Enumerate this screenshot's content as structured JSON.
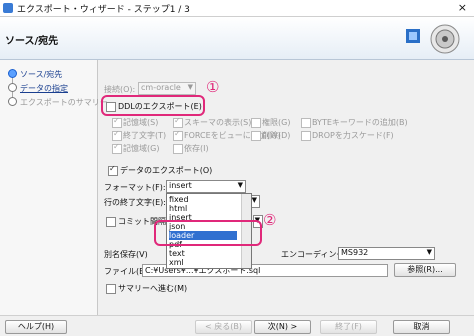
{
  "window": {
    "title": "エクスポート・ウィザード - ステップ1 / 3",
    "close": "×"
  },
  "header": {
    "title": "ソース/宛先"
  },
  "nav": [
    {
      "label": "ソース/宛先",
      "state": "active"
    },
    {
      "label": "データの指定",
      "state": "link"
    },
    {
      "label": "エクスポートのサマリー",
      "state": "disabled"
    }
  ],
  "connection": {
    "label": "接続(O):",
    "value": "cm-oracle"
  },
  "ddl": {
    "label": "DDLのエクスポート(E)"
  },
  "ddl_options": [
    {
      "label": "記憶域(S)",
      "checked": true
    },
    {
      "label": "スキーマの表示(S)",
      "checked": true
    },
    {
      "label": "権限(G)",
      "checked": false
    },
    {
      "label": "BYTEキーワードの追加(B)",
      "checked": false
    },
    {
      "label": "終了文字(T)",
      "checked": true
    },
    {
      "label": "FORCEをビューに追加(W)",
      "checked": true
    },
    {
      "label": "削除(D)",
      "checked": false
    },
    {
      "label": "DROPを力スケード(F)",
      "checked": false
    },
    {
      "label": "記憶域(G)",
      "checked": true
    },
    {
      "label": "依存(I)",
      "checked": false
    }
  ],
  "data_export": {
    "label": "データのエクスポート(O)"
  },
  "format": {
    "label": "フォーマット(F):",
    "value": "insert",
    "options": [
      "fixed",
      "html",
      "insert",
      "json",
      "loader",
      "pdf",
      "text",
      "xml"
    ],
    "selected": "loader"
  },
  "line_end": {
    "label": "行の終了文字(E):"
  },
  "commit": {
    "label": "コミット間隔を含"
  },
  "save_as": {
    "label": "別名保存(V)"
  },
  "encoding": {
    "label": "エンコーディング(I):",
    "value": "MS932"
  },
  "file": {
    "label": "ファイル(E):",
    "value": "C:¥Users¥...¥エクスポート.sql",
    "browse": "参照(R)..."
  },
  "summary": {
    "label": "サマリーへ進む(M)"
  },
  "markers": {
    "one": "①",
    "two": "②"
  },
  "footer": {
    "help": "ヘルプ(H)",
    "back": "< 戻る(B)",
    "next": "次(N) >",
    "finish": "終了(F)",
    "cancel": "取消"
  }
}
